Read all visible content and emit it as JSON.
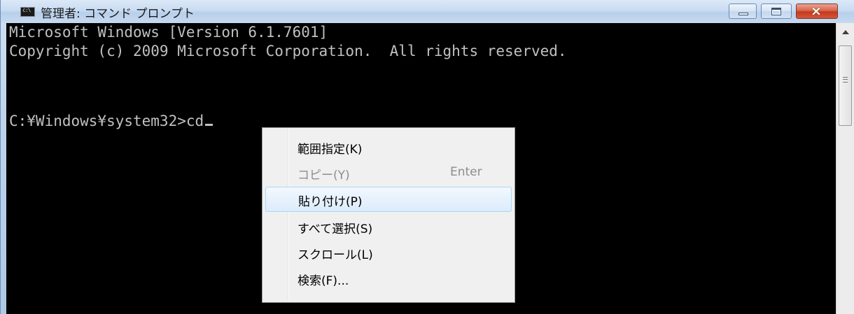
{
  "window": {
    "title": "管理者: コマンド プロンプト",
    "icon": "cmd-icon",
    "buttons": {
      "minimize": "minimize-icon",
      "maximize": "maximize-icon",
      "close": "×"
    }
  },
  "console": {
    "lines": [
      "Microsoft Windows [Version 6.1.7601]",
      "Copyright (c) 2009 Microsoft Corporation.  All rights reserved.",
      "",
      "C:¥Windows¥system32>cd"
    ],
    "text_color": "#c0c0c0",
    "background": "#000000"
  },
  "context_menu": {
    "items": [
      {
        "label": "範囲指定(K)",
        "shortcut": "",
        "enabled": true
      },
      {
        "label": "コピー(Y)",
        "shortcut": "Enter",
        "enabled": false
      },
      {
        "label": "貼り付け(P)",
        "shortcut": "",
        "enabled": true,
        "highlighted": true
      },
      {
        "label": "すべて選択(S)",
        "shortcut": "",
        "enabled": true
      },
      {
        "label": "スクロール(L)",
        "shortcut": "",
        "enabled": true
      },
      {
        "label": "検索(F)...",
        "shortcut": "",
        "enabled": true
      }
    ]
  }
}
